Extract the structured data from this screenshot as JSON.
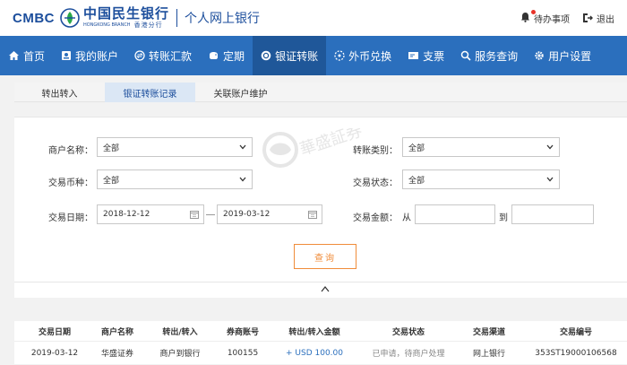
{
  "header": {
    "logo_text": "CMBC",
    "bank_name_cn": "中国民生银行",
    "bank_name_en": "HONGKONG BRANCH",
    "bank_name_hk": "香港分行",
    "app_title": "个人网上银行",
    "todo_label": "待办事项",
    "logout_label": "退出",
    "brand_color": "#1c4e9c"
  },
  "nav": {
    "color": "#2b6fbd",
    "items": [
      {
        "label": "首页",
        "icon": "home-icon"
      },
      {
        "label": "我的账户",
        "icon": "account-icon"
      },
      {
        "label": "转账汇款",
        "icon": "transfer-icon"
      },
      {
        "label": "定期",
        "icon": "deposit-icon"
      },
      {
        "label": "银证转账",
        "icon": "securities-transfer-icon",
        "active": true
      },
      {
        "label": "外币兑换",
        "icon": "exchange-icon"
      },
      {
        "label": "支票",
        "icon": "cheque-icon"
      },
      {
        "label": "服务查询",
        "icon": "search-icon"
      },
      {
        "label": "用户设置",
        "icon": "gear-icon"
      }
    ]
  },
  "subtabs": [
    {
      "label": "转出转入"
    },
    {
      "label": "银证转账记录",
      "active": true
    },
    {
      "label": "关联账户维护"
    }
  ],
  "form": {
    "merchant_label": "商户名称：",
    "merchant_value": "全部",
    "transfer_type_label": "转账类别：",
    "transfer_type_value": "全部",
    "currency_label": "交易币种：",
    "currency_value": "全部",
    "status_label": "交易状态：",
    "status_value": "全部",
    "date_label": "交易日期：",
    "date_from": "2018-12-12",
    "date_to": "2019-03-12",
    "amount_label": "交易金额：",
    "amount_from_label": "从",
    "amount_to_label": "到",
    "query_button": "查询",
    "query_color": "#f08c3a",
    "watermark_text": "華盛証券"
  },
  "table": {
    "headers": [
      "交易日期",
      "商户名称",
      "转出/转入",
      "券商账号",
      "转出/转入金额",
      "交易状态",
      "交易渠道",
      "交易编号"
    ],
    "rows": [
      [
        "2019-03-12",
        "华盛证券",
        "商户到银行",
        "100155",
        "+ USD 100.00",
        "已申请，待商户处理",
        "网上银行",
        "353ST19000106568"
      ]
    ]
  }
}
